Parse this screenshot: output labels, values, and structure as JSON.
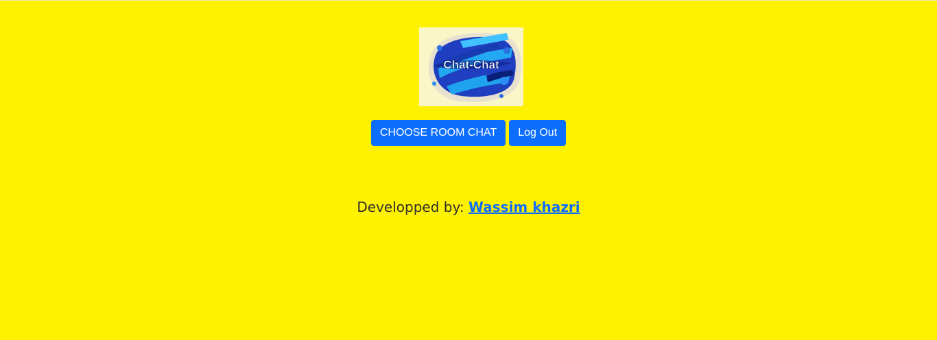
{
  "logo": {
    "text": "Chat-Chat",
    "icon": "chat-chat-logo"
  },
  "buttons": {
    "choose_room": "CHOOSE ROOM CHAT",
    "logout": "Log Out"
  },
  "footer": {
    "credit_prefix": "Developped by: ",
    "author": "Wassim khazri"
  },
  "colors": {
    "background": "#fff200",
    "button": "#0d6efd",
    "link": "#0d6efd"
  }
}
